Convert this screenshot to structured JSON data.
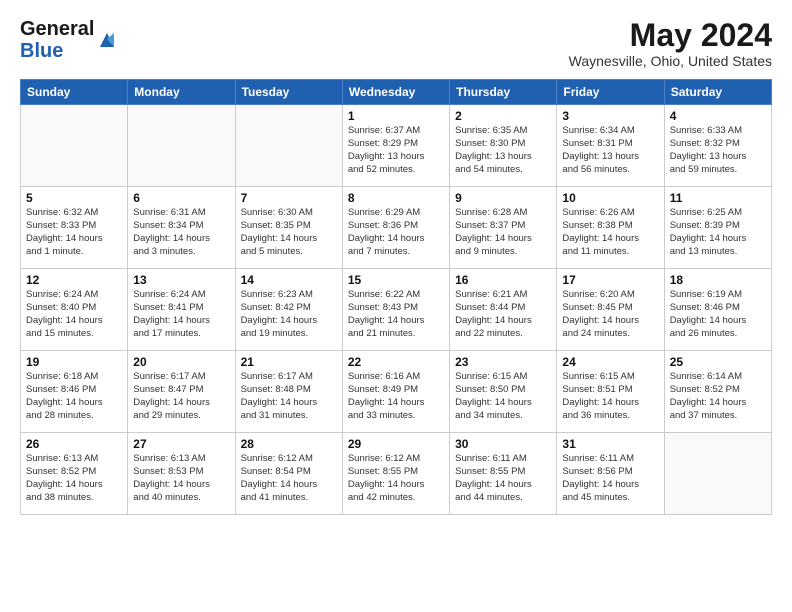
{
  "header": {
    "logo_general": "General",
    "logo_blue": "Blue",
    "month_title": "May 2024",
    "location": "Waynesville, Ohio, United States"
  },
  "days_of_week": [
    "Sunday",
    "Monday",
    "Tuesday",
    "Wednesday",
    "Thursday",
    "Friday",
    "Saturday"
  ],
  "weeks": [
    [
      {
        "day": "",
        "info": ""
      },
      {
        "day": "",
        "info": ""
      },
      {
        "day": "",
        "info": ""
      },
      {
        "day": "1",
        "info": "Sunrise: 6:37 AM\nSunset: 8:29 PM\nDaylight: 13 hours\nand 52 minutes."
      },
      {
        "day": "2",
        "info": "Sunrise: 6:35 AM\nSunset: 8:30 PM\nDaylight: 13 hours\nand 54 minutes."
      },
      {
        "day": "3",
        "info": "Sunrise: 6:34 AM\nSunset: 8:31 PM\nDaylight: 13 hours\nand 56 minutes."
      },
      {
        "day": "4",
        "info": "Sunrise: 6:33 AM\nSunset: 8:32 PM\nDaylight: 13 hours\nand 59 minutes."
      }
    ],
    [
      {
        "day": "5",
        "info": "Sunrise: 6:32 AM\nSunset: 8:33 PM\nDaylight: 14 hours\nand 1 minute."
      },
      {
        "day": "6",
        "info": "Sunrise: 6:31 AM\nSunset: 8:34 PM\nDaylight: 14 hours\nand 3 minutes."
      },
      {
        "day": "7",
        "info": "Sunrise: 6:30 AM\nSunset: 8:35 PM\nDaylight: 14 hours\nand 5 minutes."
      },
      {
        "day": "8",
        "info": "Sunrise: 6:29 AM\nSunset: 8:36 PM\nDaylight: 14 hours\nand 7 minutes."
      },
      {
        "day": "9",
        "info": "Sunrise: 6:28 AM\nSunset: 8:37 PM\nDaylight: 14 hours\nand 9 minutes."
      },
      {
        "day": "10",
        "info": "Sunrise: 6:26 AM\nSunset: 8:38 PM\nDaylight: 14 hours\nand 11 minutes."
      },
      {
        "day": "11",
        "info": "Sunrise: 6:25 AM\nSunset: 8:39 PM\nDaylight: 14 hours\nand 13 minutes."
      }
    ],
    [
      {
        "day": "12",
        "info": "Sunrise: 6:24 AM\nSunset: 8:40 PM\nDaylight: 14 hours\nand 15 minutes."
      },
      {
        "day": "13",
        "info": "Sunrise: 6:24 AM\nSunset: 8:41 PM\nDaylight: 14 hours\nand 17 minutes."
      },
      {
        "day": "14",
        "info": "Sunrise: 6:23 AM\nSunset: 8:42 PM\nDaylight: 14 hours\nand 19 minutes."
      },
      {
        "day": "15",
        "info": "Sunrise: 6:22 AM\nSunset: 8:43 PM\nDaylight: 14 hours\nand 21 minutes."
      },
      {
        "day": "16",
        "info": "Sunrise: 6:21 AM\nSunset: 8:44 PM\nDaylight: 14 hours\nand 22 minutes."
      },
      {
        "day": "17",
        "info": "Sunrise: 6:20 AM\nSunset: 8:45 PM\nDaylight: 14 hours\nand 24 minutes."
      },
      {
        "day": "18",
        "info": "Sunrise: 6:19 AM\nSunset: 8:46 PM\nDaylight: 14 hours\nand 26 minutes."
      }
    ],
    [
      {
        "day": "19",
        "info": "Sunrise: 6:18 AM\nSunset: 8:46 PM\nDaylight: 14 hours\nand 28 minutes."
      },
      {
        "day": "20",
        "info": "Sunrise: 6:17 AM\nSunset: 8:47 PM\nDaylight: 14 hours\nand 29 minutes."
      },
      {
        "day": "21",
        "info": "Sunrise: 6:17 AM\nSunset: 8:48 PM\nDaylight: 14 hours\nand 31 minutes."
      },
      {
        "day": "22",
        "info": "Sunrise: 6:16 AM\nSunset: 8:49 PM\nDaylight: 14 hours\nand 33 minutes."
      },
      {
        "day": "23",
        "info": "Sunrise: 6:15 AM\nSunset: 8:50 PM\nDaylight: 14 hours\nand 34 minutes."
      },
      {
        "day": "24",
        "info": "Sunrise: 6:15 AM\nSunset: 8:51 PM\nDaylight: 14 hours\nand 36 minutes."
      },
      {
        "day": "25",
        "info": "Sunrise: 6:14 AM\nSunset: 8:52 PM\nDaylight: 14 hours\nand 37 minutes."
      }
    ],
    [
      {
        "day": "26",
        "info": "Sunrise: 6:13 AM\nSunset: 8:52 PM\nDaylight: 14 hours\nand 38 minutes."
      },
      {
        "day": "27",
        "info": "Sunrise: 6:13 AM\nSunset: 8:53 PM\nDaylight: 14 hours\nand 40 minutes."
      },
      {
        "day": "28",
        "info": "Sunrise: 6:12 AM\nSunset: 8:54 PM\nDaylight: 14 hours\nand 41 minutes."
      },
      {
        "day": "29",
        "info": "Sunrise: 6:12 AM\nSunset: 8:55 PM\nDaylight: 14 hours\nand 42 minutes."
      },
      {
        "day": "30",
        "info": "Sunrise: 6:11 AM\nSunset: 8:55 PM\nDaylight: 14 hours\nand 44 minutes."
      },
      {
        "day": "31",
        "info": "Sunrise: 6:11 AM\nSunset: 8:56 PM\nDaylight: 14 hours\nand 45 minutes."
      },
      {
        "day": "",
        "info": ""
      }
    ]
  ]
}
